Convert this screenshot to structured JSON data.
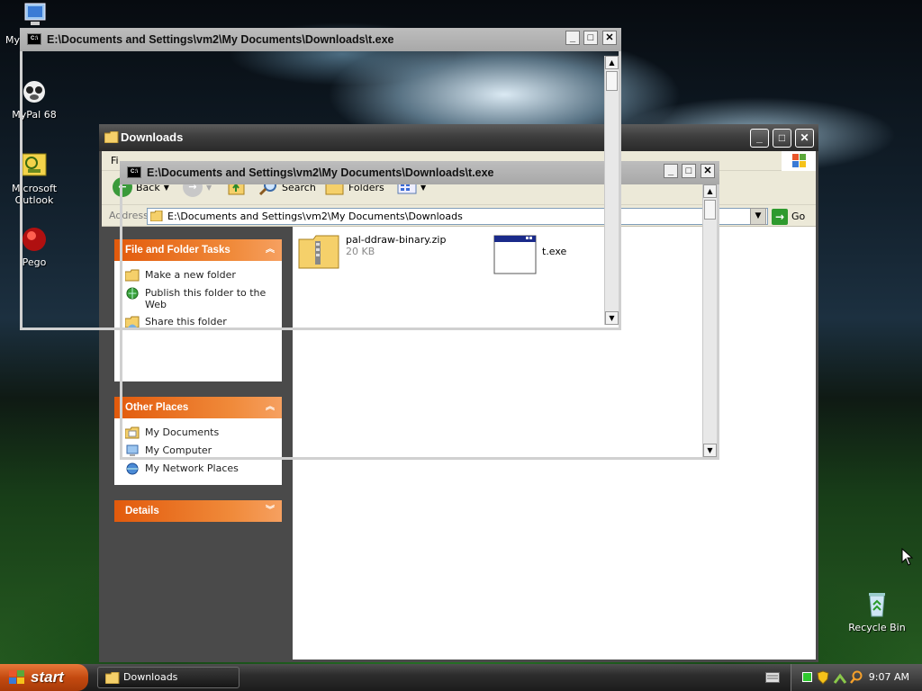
{
  "desktop": {
    "icons": [
      {
        "label": "My",
        "icon": "my-computer-icon"
      },
      {
        "label": "MyPal 68",
        "icon": "mypal-icon"
      },
      {
        "label": "Microsoft Outlook",
        "icon": "outlook-icon"
      },
      {
        "label": "Pego",
        "icon": "pego-icon"
      },
      {
        "label": "Recycle Bin",
        "icon": "recycle-bin-icon"
      }
    ]
  },
  "explorer": {
    "title": "Downloads",
    "menu_first": "Fi",
    "toolbar": {
      "back": "Back",
      "search": "Search",
      "folders": "Folders"
    },
    "address": {
      "label": "Address",
      "value": "E:\\Documents and Settings\\vm2\\My Documents\\Downloads",
      "go": "Go"
    },
    "tasks": {
      "title": "File and Folder Tasks",
      "items": [
        "Make a new folder",
        "Publish this folder to the Web",
        "Share this folder"
      ]
    },
    "other_places": {
      "title": "Other Places",
      "items": [
        "My Documents",
        "My Computer",
        "My Network Places"
      ]
    },
    "details": {
      "title": "Details"
    },
    "files": [
      {
        "name": "pal-ddraw-binary.zip",
        "size": "20 KB",
        "icon": "zip-folder-icon"
      },
      {
        "name": "t.exe",
        "size": "",
        "icon": "exe-window-icon"
      }
    ]
  },
  "console1": {
    "title": "E:\\Documents and Settings\\vm2\\My Documents\\Downloads\\t.exe"
  },
  "console2": {
    "title": "E:\\Documents and Settings\\vm2\\My Documents\\Downloads\\t.exe"
  },
  "console_icon_text": "C:\\",
  "taskbar": {
    "start": "start",
    "task": "Downloads",
    "time": "9:07 AM"
  }
}
